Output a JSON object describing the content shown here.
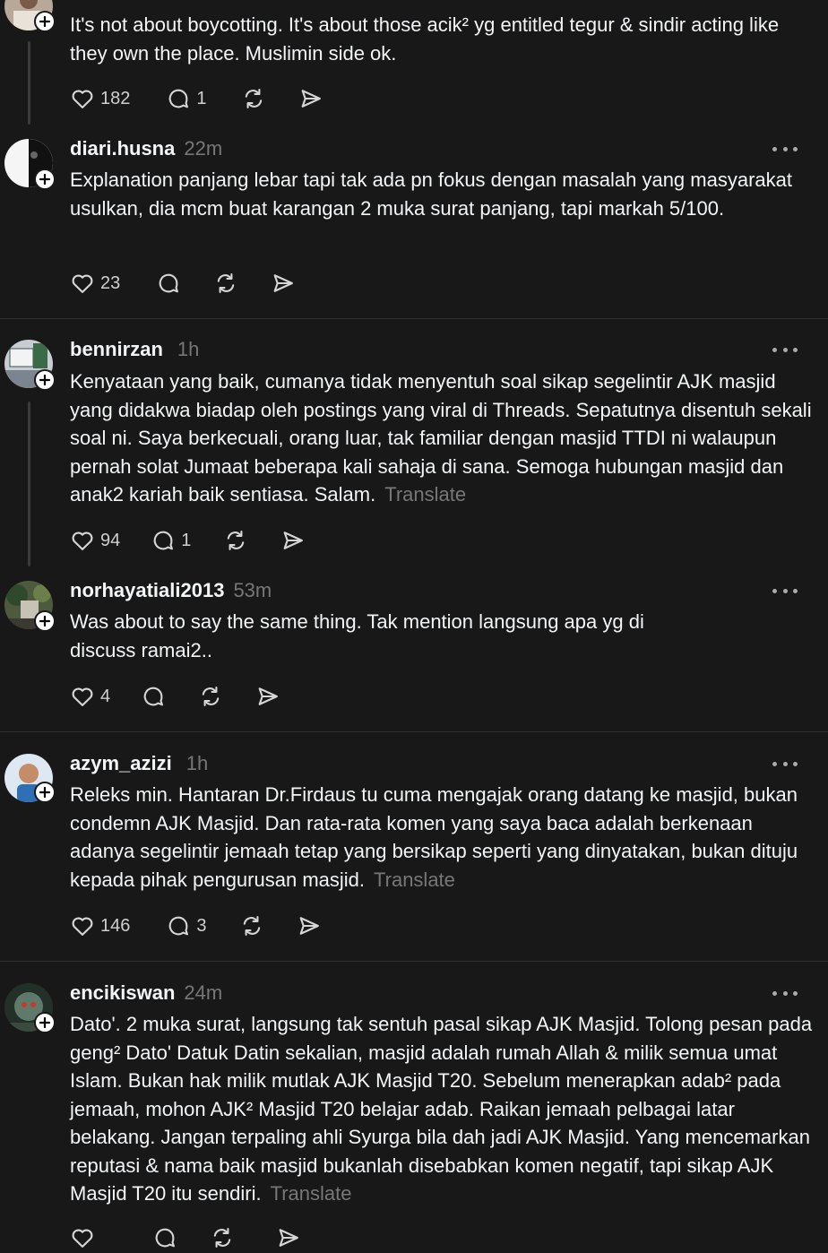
{
  "posts": [
    {
      "text": "It's not about boycotting. It's about those acik² yg entitled tegur & sindir acting like they own the place. Muslimin side ok.",
      "likes": "182",
      "replies": "1"
    },
    {
      "username": "diari.husna",
      "time": "22m",
      "text": "Explanation panjang lebar tapi tak ada pn fokus dengan masalah yang masyarakat usulkan, dia mcm buat karangan 2 muka surat panjang, tapi markah 5/100.",
      "likes": "23"
    },
    {
      "username": "bennirzan",
      "time": "1h",
      "text": "Kenyataan yang baik, cumanya tidak menyentuh soal sikap segelintir AJK masjid yang didakwa biadap oleh postings yang viral di Threads. Sepatutnya disentuh sekali soal ni. Saya berkecuali, orang luar, tak familiar dengan masjid TTDI ni walaupun pernah solat Jumaat beberapa kali sahaja di sana. Semoga hubungan masjid dan anak2 kariah baik sentiasa. Salam.",
      "translate": "Translate",
      "likes": "94",
      "replies": "1"
    },
    {
      "username": "norhayatiali2013",
      "time": "53m",
      "text": "Was about to say the same thing. Tak mention langsung apa yg di discuss ramai2..",
      "likes": "4"
    },
    {
      "username": "azym_azizi",
      "time": "1h",
      "text": "Releks min. Hantaran Dr.Firdaus tu cuma mengajak orang datang ke masjid, bukan condemn AJK Masjid. Dan rata-rata komen yang saya baca adalah berkenaan adanya segelintir jemaah tetap yang bersikap seperti yang dinyatakan, bukan dituju kepada pihak pengurusan masjid.",
      "translate": "Translate",
      "likes": "146",
      "replies": "3"
    },
    {
      "username": "encikiswan",
      "time": "24m",
      "text": "Dato'. 2 muka surat, langsung tak sentuh pasal sikap AJK Masjid. Tolong pesan pada geng² Dato' Datuk Datin sekalian, masjid adalah rumah Allah & milik semua umat Islam. Bukan hak milik mutlak AJK Masjid T20. Sebelum menerapkan adab² pada jemaah, mohon AJK² Masjid T20 belajar adab. Raikan jemaah pelbagai latar belakang. Jangan terpaling ahli Syurga bila dah jadi AJK Masjid. Yang mencemarkan reputasi & nama baik masjid bukanlah disebabkan komen negatif, tapi sikap AJK Masjid T20 itu sendiri.",
      "translate": "Translate"
    }
  ]
}
